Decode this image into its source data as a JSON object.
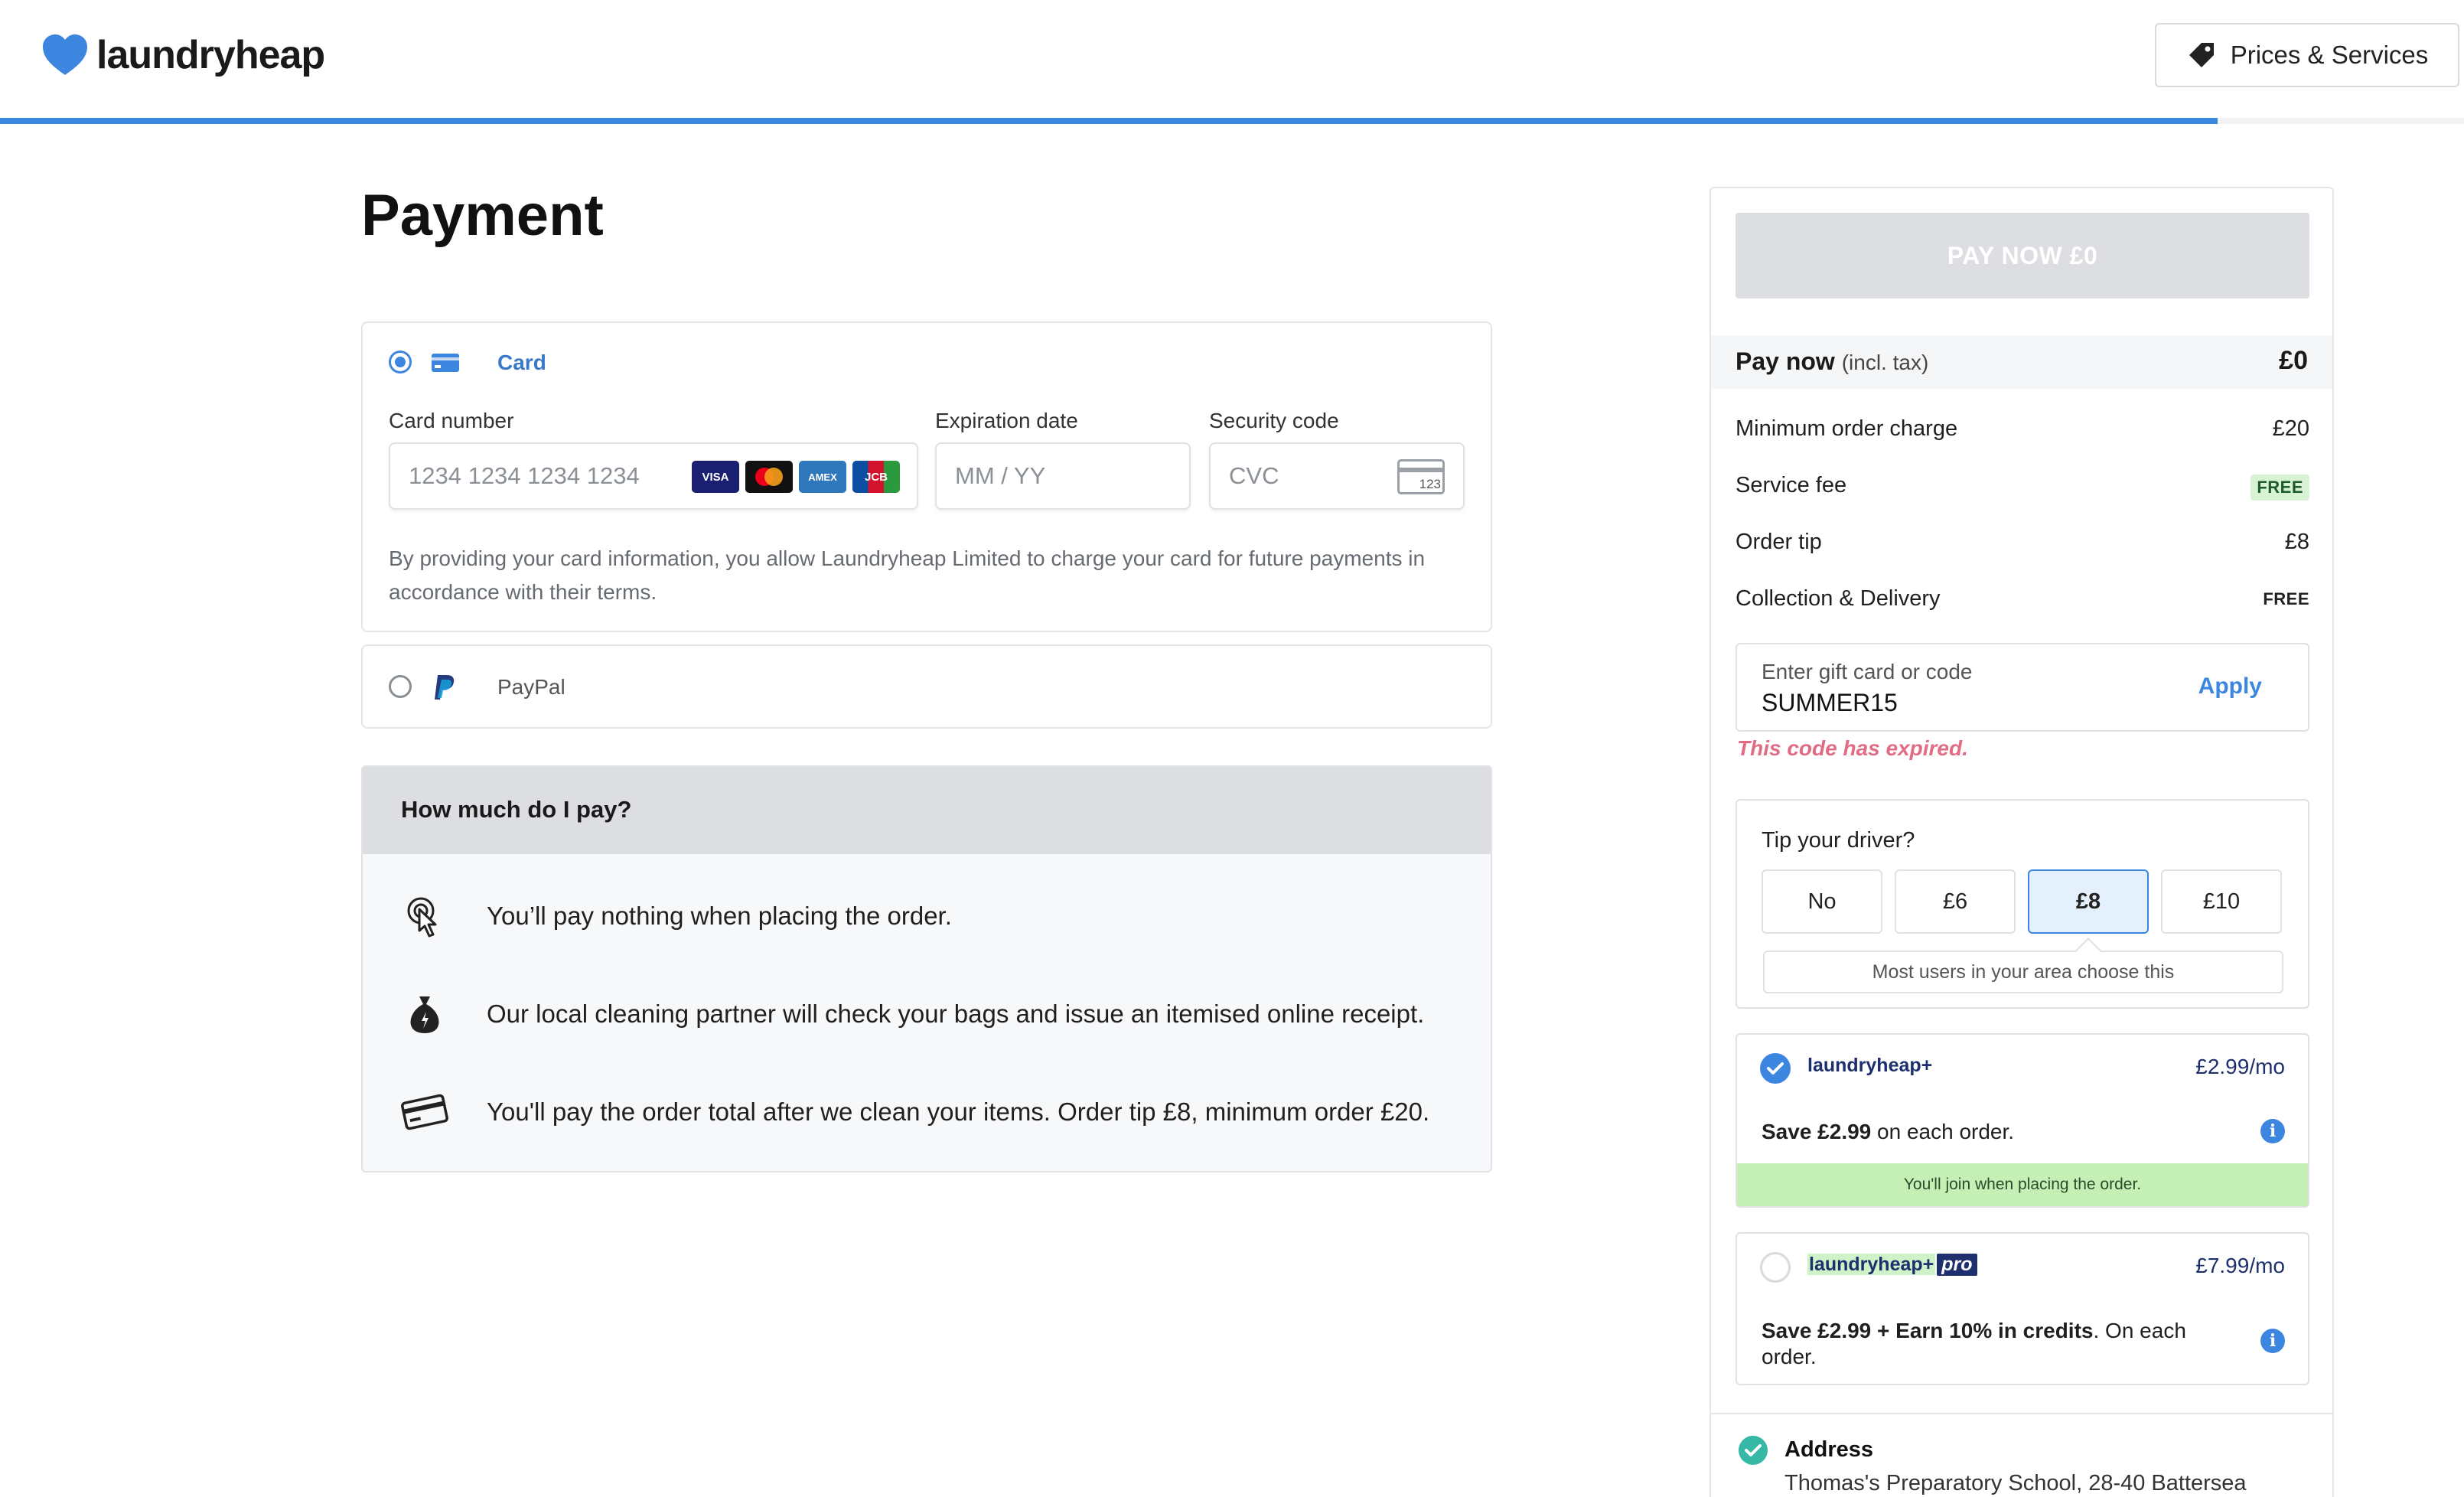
{
  "header": {
    "logo_text": "laundryheap",
    "prices_button": "Prices & Services",
    "progress": 0.9
  },
  "page": {
    "title": "Payment"
  },
  "payment_methods": {
    "card": {
      "label": "Card",
      "selected": true,
      "card_number_label": "Card number",
      "card_number_placeholder": "1234 1234 1234 1234",
      "expiry_label": "Expiration date",
      "expiry_placeholder": "MM / YY",
      "cvc_label": "Security code",
      "cvc_placeholder": "CVC",
      "cvc_icon_text": "123",
      "brands": [
        "VISA",
        "MC",
        "AMEX",
        "JCB"
      ],
      "consent": "By providing your card information, you allow Laundryheap Limited to charge your card for future payments in accordance with their terms."
    },
    "paypal": {
      "label": "PayPal",
      "selected": false
    }
  },
  "how_much": {
    "title": "How much do I pay?",
    "items": [
      {
        "icon": "tap-icon",
        "text": "You’ll pay nothing when placing the order."
      },
      {
        "icon": "money-bag-icon",
        "text": "Our local cleaning partner will check your bags and issue an itemised online receipt."
      },
      {
        "icon": "credit-card-icon",
        "text": "You'll pay the order total after we clean your items. Order tip £8, minimum order £20."
      }
    ]
  },
  "summary": {
    "pay_button": "PAY NOW £0",
    "pay_now_label": "Pay now",
    "pay_now_note": "(incl. tax)",
    "pay_now_value": "£0",
    "lines": [
      {
        "label": "Minimum order charge",
        "value": "£20"
      },
      {
        "label": "Service fee",
        "value": "FREE"
      },
      {
        "label": "Order tip",
        "value": "£8"
      },
      {
        "label": "Collection & Delivery",
        "value": "FREE"
      }
    ],
    "gift": {
      "placeholder": "Enter gift card or code",
      "value": "SUMMER15",
      "apply": "Apply",
      "error": "This code has expired."
    },
    "tip": {
      "title": "Tip your driver?",
      "options": [
        "No",
        "£6",
        "£8",
        "£10"
      ],
      "selected": "£8",
      "note": "Most users in your area choose this"
    },
    "plans": [
      {
        "name": "laundryheap+",
        "price": "£2.99/mo",
        "desc_bold": "Save £2.99",
        "desc_rest": " on each order.",
        "join": "You'll join when placing the order.",
        "selected": true
      },
      {
        "name": "laundryheap+",
        "badge": "pro",
        "price": "£7.99/mo",
        "desc_bold": "Save £2.99 + Earn 10% in credits",
        "desc_rest": ". On each order.",
        "selected": false
      }
    ],
    "address": {
      "title": "Address",
      "text": "Thomas's Preparatory School, 28-40 Battersea"
    }
  },
  "colors": {
    "accent": "#3d86e0",
    "free_badge": "#d8f3d4",
    "error": "#e26b85",
    "join_bar": "#c5f0b5",
    "address_check": "#35b9a6"
  }
}
